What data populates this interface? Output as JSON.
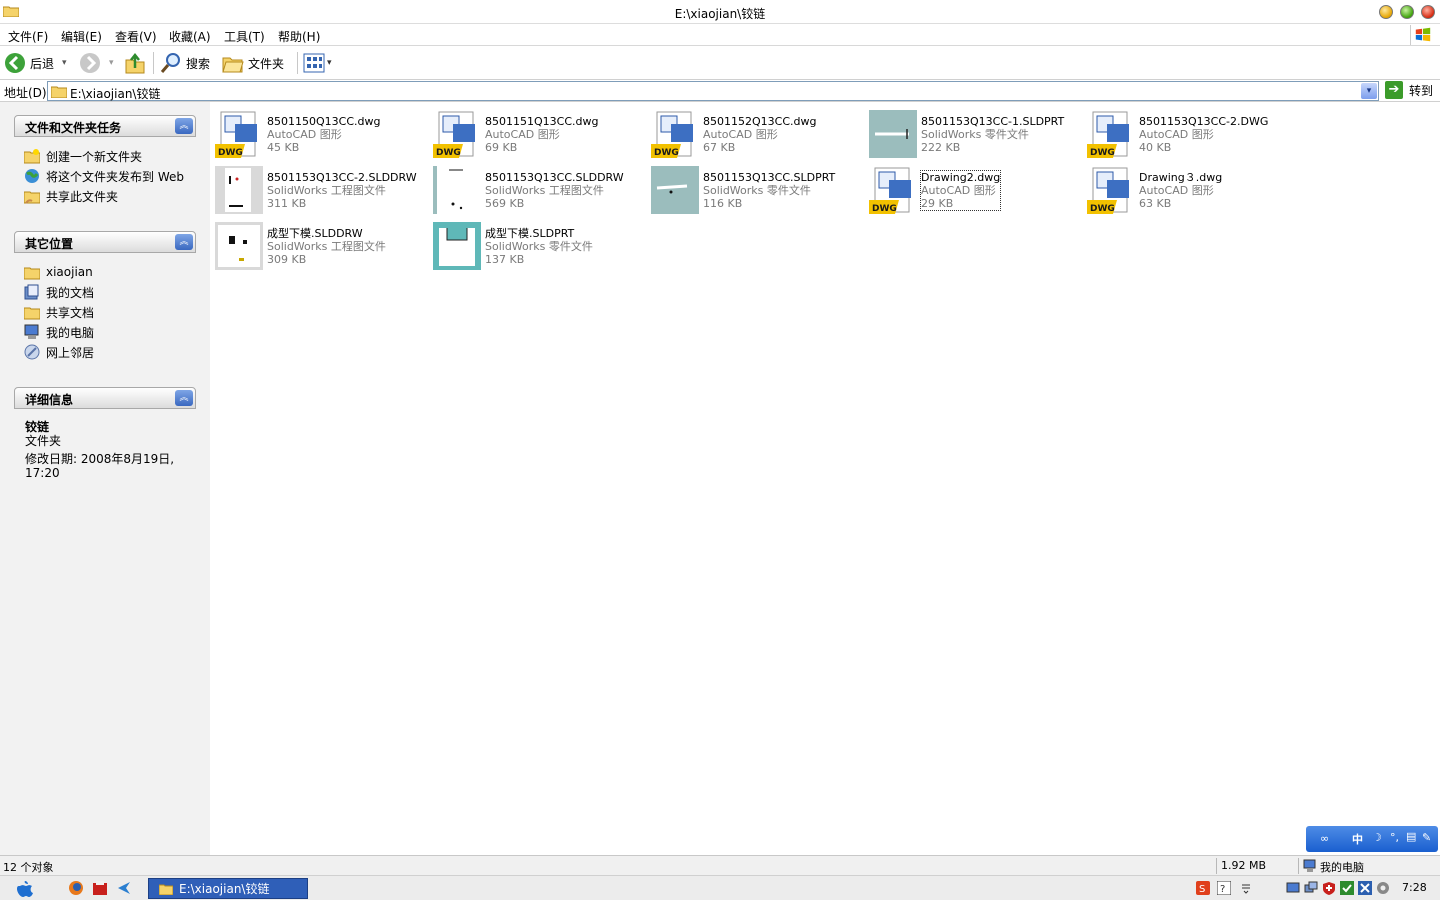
{
  "window": {
    "title": "E:\\xiaojian\\铰链"
  },
  "menu": [
    "文件(F)",
    "编辑(E)",
    "查看(V)",
    "收藏(A)",
    "工具(T)",
    "帮助(H)"
  ],
  "toolbar": {
    "back": "后退",
    "search": "搜索",
    "folders": "文件夹"
  },
  "address": {
    "label": "地址(D)",
    "value": "E:\\xiaojian\\铰链",
    "go": "转到"
  },
  "tasks": {
    "title": "文件和文件夹任务",
    "items": [
      "创建一个新文件夹",
      "将这个文件夹发布到 Web",
      "共享此文件夹"
    ]
  },
  "places": {
    "title": "其它位置",
    "items": [
      "xiaojian",
      "我的文档",
      "共享文档",
      "我的电脑",
      "网上邻居"
    ]
  },
  "details": {
    "title": "详细信息",
    "name": "铰链",
    "kind": "文件夹",
    "modified": "修改日期: 2008年8月19日,",
    "time": "17:20"
  },
  "files": [
    {
      "name": "8501150Q13CC.dwg",
      "type": "AutoCAD 图形",
      "size": "45 KB",
      "icon": "dwg-icon"
    },
    {
      "name": "8501151Q13CC.dwg",
      "type": "AutoCAD 图形",
      "size": "69 KB",
      "icon": "dwg-icon"
    },
    {
      "name": "8501152Q13CC.dwg",
      "type": "AutoCAD 图形",
      "size": "67 KB",
      "icon": "dwg-icon"
    },
    {
      "name": "8501153Q13CC-1.SLDPRT",
      "type": "SolidWorks 零件文件",
      "size": "222 KB",
      "icon": "part-thumbnail"
    },
    {
      "name": "8501153Q13CC-2.DWG",
      "type": "AutoCAD 图形",
      "size": "40 KB",
      "icon": "dwg-icon"
    },
    {
      "name": "8501153Q13CC-2.SLDDRW",
      "type": "SolidWorks 工程图文件",
      "size": "311 KB",
      "icon": "drawing-thumbnail"
    },
    {
      "name": "8501153Q13CC.SLDDRW",
      "type": "SolidWorks 工程图文件",
      "size": "569 KB",
      "icon": "drawing-thumbnail"
    },
    {
      "name": "8501153Q13CC.SLDPRT",
      "type": "SolidWorks 零件文件",
      "size": "116 KB",
      "icon": "part-thumbnail"
    },
    {
      "name": "Drawing2.dwg",
      "type": "AutoCAD 图形",
      "size": "29 KB",
      "icon": "dwg-icon"
    },
    {
      "name": "Drawing３.dwg",
      "type": "AutoCAD 图形",
      "size": "63 KB",
      "icon": "dwg-icon"
    },
    {
      "name": "成型下模.SLDDRW",
      "type": "SolidWorks 工程图文件",
      "size": "309 KB",
      "icon": "drawing-thumbnail"
    },
    {
      "name": "成型下模.SLDPRT",
      "type": "SolidWorks 零件文件",
      "size": "137 KB",
      "icon": "part-thumbnail"
    }
  ],
  "status": {
    "count": "12 个对象",
    "size": "1.92 MB",
    "location": "我的电脑"
  },
  "ime": {
    "label": "中"
  },
  "taskbar": {
    "task": "E:\\xiaojian\\铰链",
    "clock": "7:28"
  }
}
